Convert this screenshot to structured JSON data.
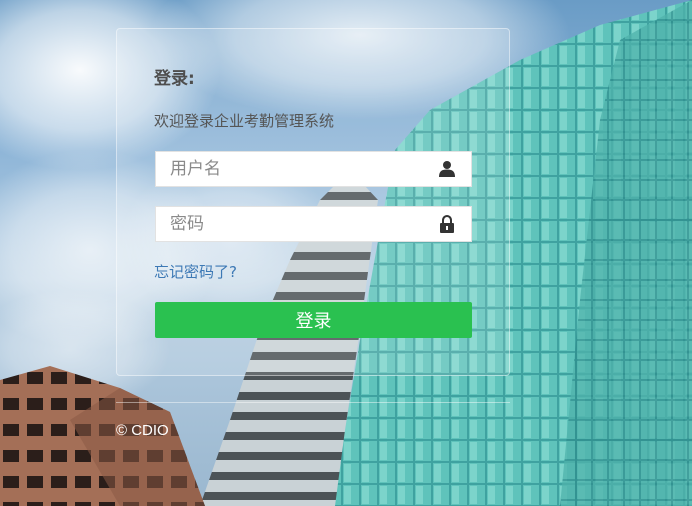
{
  "login": {
    "title": "登录:",
    "subtitle": "欢迎登录企业考勤管理系统",
    "username_placeholder": "用户名",
    "password_placeholder": "密码",
    "forgot_password": "忘记密码了?",
    "submit_label": "登录"
  },
  "footer": {
    "copyright": "© CDIO"
  },
  "colors": {
    "primary": "#2ac150",
    "link": "#3d79b5"
  },
  "icons": {
    "username": "user-icon",
    "password": "lock-icon"
  }
}
